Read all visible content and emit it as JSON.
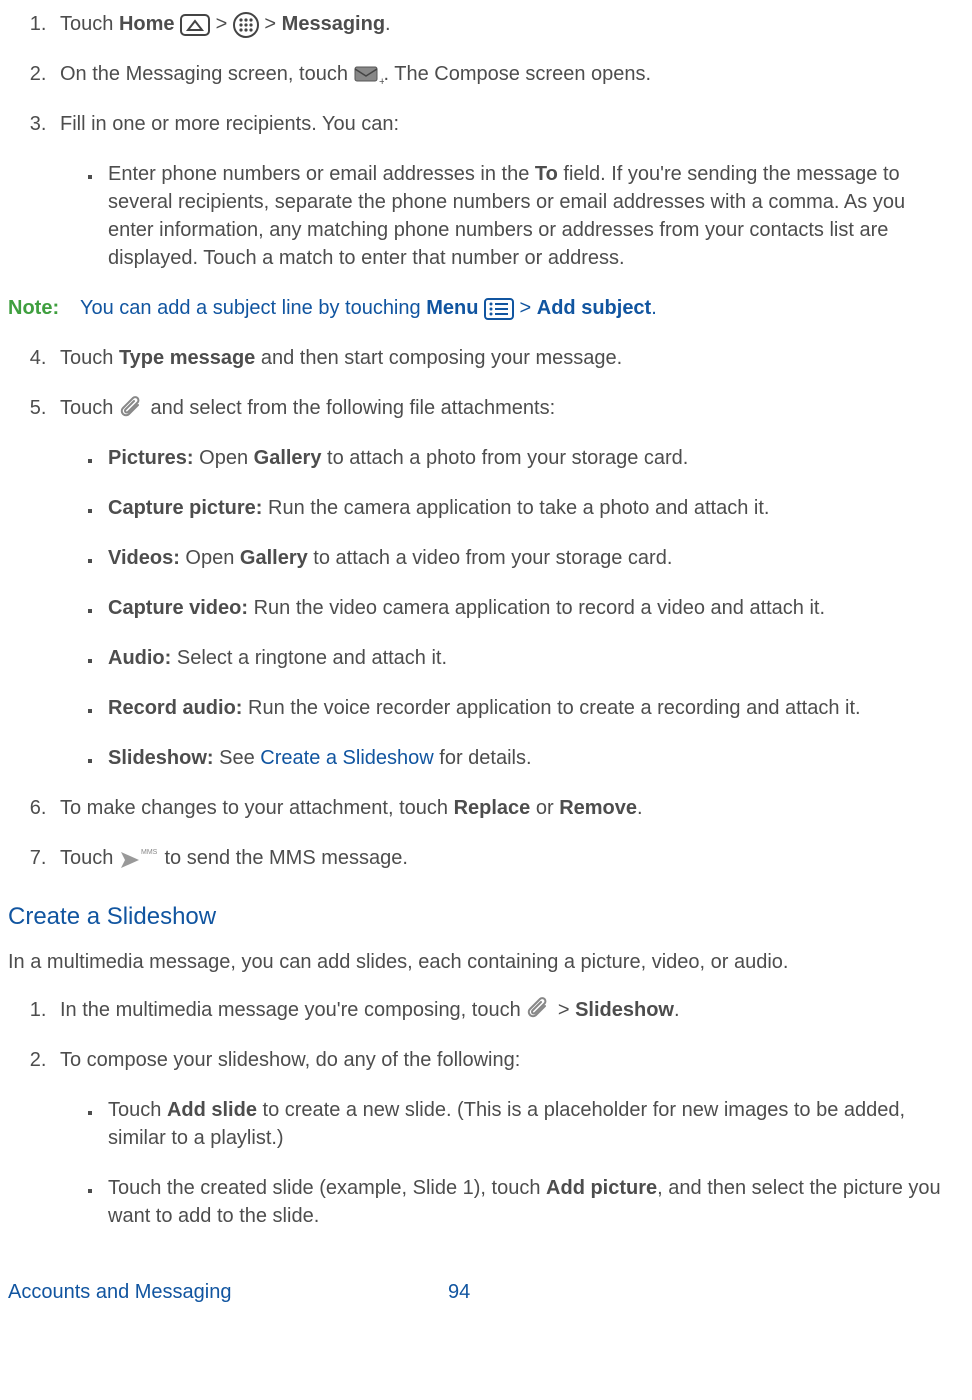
{
  "step1": {
    "n": "1.",
    "a": "Touch ",
    "b": "Home",
    "gt1": " > ",
    "gt2": " > ",
    "c": "Messaging",
    "d": "."
  },
  "step2": {
    "n": "2.",
    "a": "On the Messaging screen, touch ",
    "b": ". The Compose screen opens."
  },
  "step3": {
    "n": "3.",
    "a": "Fill in one or more recipients. You can:"
  },
  "step3_b1": {
    "a": "Enter phone numbers or email addresses in the ",
    "b": "To",
    "c": " field. If you're sending the message to several recipients, separate the phone numbers or email addresses with a comma. As you enter information, any matching phone numbers or addresses from your contacts list are displayed. Touch a match to enter that number or address."
  },
  "note": {
    "label": "Note:",
    "a": "You can add a subject line by touching ",
    "b": "Menu",
    "gt": " > ",
    "c": "Add subject",
    "d": "."
  },
  "step4": {
    "n": "4.",
    "a": "Touch ",
    "b": "Type message",
    "c": " and then start composing your message."
  },
  "step5": {
    "n": "5.",
    "a": "Touch ",
    "b": " and select from the following file attachments:"
  },
  "att": {
    "pictures_l": "Pictures:",
    "pictures_a": " Open ",
    "pictures_b": "Gallery",
    "pictures_c": " to attach a photo from your storage card.",
    "cappic_l": "Capture picture:",
    "cappic_a": " Run the camera application to take a photo and attach it.",
    "videos_l": "Videos:",
    "videos_a": " Open ",
    "videos_b": "Gallery",
    "videos_c": " to attach a video from your storage card.",
    "capvid_l": "Capture video:",
    "capvid_a": " Run the video camera application to record a video and attach it.",
    "audio_l": "Audio:",
    "audio_a": " Select a ringtone and attach it.",
    "recaud_l": "Record audio:",
    "recaud_a": " Run the voice recorder application to create a recording and attach it.",
    "slide_l": "Slideshow:",
    "slide_a": " See ",
    "slide_link": "Create a Slideshow",
    "slide_b": " for details."
  },
  "step6": {
    "n": "6.",
    "a": "To make changes to your attachment, touch ",
    "b": "Replace",
    "c": " or ",
    "d": "Remove",
    "e": "."
  },
  "step7": {
    "n": "7.",
    "a": "Touch ",
    "b": " to send the MMS message."
  },
  "section_title": "Create a Slideshow",
  "section_intro": "In a multimedia message, you can add slides, each containing a picture, video, or audio.",
  "sstep1": {
    "n": "1.",
    "a": "In the multimedia message you're composing, touch ",
    "gt": " > ",
    "b": "Slideshow",
    "c": "."
  },
  "sstep2": {
    "n": "2.",
    "a": "To compose your slideshow, do any of the following:"
  },
  "sb1": {
    "a": "Touch ",
    "b": "Add slide",
    "c": " to create a new slide. (This is a placeholder for new images to be added, similar to a playlist.)"
  },
  "sb2": {
    "a": "Touch the created slide (example, Slide 1), touch ",
    "b": "Add picture",
    "c": ", and then select the picture you want to add to the slide."
  },
  "footer": {
    "left": "Accounts and Messaging",
    "right": "94"
  },
  "mms_label": "MMS"
}
